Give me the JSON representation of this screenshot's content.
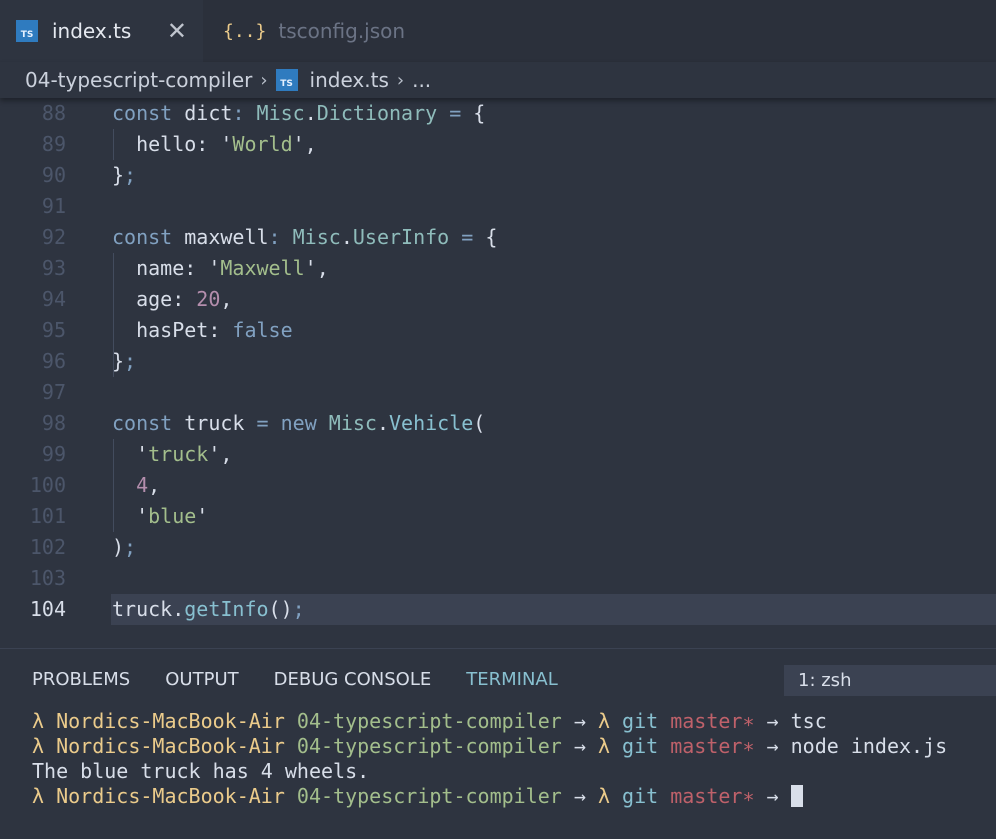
{
  "tabs": [
    {
      "icon": "typescript-file-icon",
      "icon_text": "TS",
      "label": "index.ts",
      "active": true,
      "close": "✕"
    },
    {
      "icon": "json-file-icon",
      "icon_text": "{..}",
      "label": "tsconfig.json",
      "active": false
    }
  ],
  "breadcrumb": {
    "folder": "04-typescript-compiler",
    "separator": "›",
    "file_icon_text": "TS",
    "file": "index.ts",
    "ellipsis": "..."
  },
  "editor": {
    "current_line": "104",
    "lines": [
      {
        "n": "88",
        "code": [
          [
            "kw",
            "const"
          ],
          [
            "pl",
            " dict"
          ],
          [
            "op",
            ":"
          ],
          [
            "pl",
            " "
          ],
          [
            "ty",
            "Misc"
          ],
          [
            "pl",
            "."
          ],
          [
            "ty",
            "Dictionary"
          ],
          [
            "pl",
            " "
          ],
          [
            "op",
            "="
          ],
          [
            "pl",
            " {"
          ]
        ]
      },
      {
        "n": "89",
        "code": [
          [
            "pl",
            "  hello: '"
          ],
          [
            "str",
            "World"
          ],
          [
            "pl",
            "',"
          ]
        ]
      },
      {
        "n": "90",
        "code": [
          [
            "pl",
            "}"
          ],
          [
            "op",
            ";"
          ]
        ]
      },
      {
        "n": "91",
        "code": []
      },
      {
        "n": "92",
        "code": [
          [
            "kw",
            "const"
          ],
          [
            "pl",
            " maxwell"
          ],
          [
            "op",
            ":"
          ],
          [
            "pl",
            " "
          ],
          [
            "ty",
            "Misc"
          ],
          [
            "pl",
            "."
          ],
          [
            "ty",
            "UserInfo"
          ],
          [
            "pl",
            " "
          ],
          [
            "op",
            "="
          ],
          [
            "pl",
            " {"
          ]
        ]
      },
      {
        "n": "93",
        "code": [
          [
            "pl",
            "  name: '"
          ],
          [
            "str",
            "Maxwell"
          ],
          [
            "pl",
            "',"
          ]
        ]
      },
      {
        "n": "94",
        "code": [
          [
            "pl",
            "  age: "
          ],
          [
            "num",
            "20"
          ],
          [
            "pl",
            ","
          ]
        ]
      },
      {
        "n": "95",
        "code": [
          [
            "pl",
            "  hasPet: "
          ],
          [
            "kw",
            "false"
          ]
        ]
      },
      {
        "n": "96",
        "code": [
          [
            "pl",
            "}"
          ],
          [
            "op",
            ";"
          ]
        ]
      },
      {
        "n": "97",
        "code": []
      },
      {
        "n": "98",
        "code": [
          [
            "kw",
            "const"
          ],
          [
            "pl",
            " truck "
          ],
          [
            "op",
            "="
          ],
          [
            "pl",
            " "
          ],
          [
            "kw",
            "new"
          ],
          [
            "pl",
            " "
          ],
          [
            "ty",
            "Misc"
          ],
          [
            "pl",
            "."
          ],
          [
            "fn",
            "Vehicle"
          ],
          [
            "pl",
            "("
          ]
        ]
      },
      {
        "n": "99",
        "code": [
          [
            "pl",
            "  '"
          ],
          [
            "str",
            "truck"
          ],
          [
            "pl",
            "',"
          ]
        ]
      },
      {
        "n": "100",
        "code": [
          [
            "pl",
            "  "
          ],
          [
            "num",
            "4"
          ],
          [
            "pl",
            ","
          ]
        ]
      },
      {
        "n": "101",
        "code": [
          [
            "pl",
            "  '"
          ],
          [
            "str",
            "blue"
          ],
          [
            "pl",
            "'"
          ]
        ]
      },
      {
        "n": "102",
        "code": [
          [
            "pl",
            ")"
          ],
          [
            "op",
            ";"
          ]
        ]
      },
      {
        "n": "103",
        "code": []
      },
      {
        "n": "104",
        "code": [
          [
            "pl",
            "truck."
          ],
          [
            "fn",
            "getInfo"
          ],
          [
            "pl",
            "()"
          ],
          [
            "op",
            ";"
          ]
        ]
      }
    ]
  },
  "panel": {
    "tabs": [
      "PROBLEMS",
      "OUTPUT",
      "DEBUG CONSOLE",
      "TERMINAL"
    ],
    "active_tab": "TERMINAL",
    "terminal_select": "1: zsh"
  },
  "terminal": {
    "lines": [
      [
        [
          "t-yellow",
          "λ Nordics-MacBook-Air "
        ],
        [
          "t-green",
          "04-typescript-compiler"
        ],
        [
          "t-white",
          " → "
        ],
        [
          "t-yellow",
          "λ "
        ],
        [
          "t-cyan",
          "git "
        ],
        [
          "t-red",
          "master∗"
        ],
        [
          "t-white",
          " → tsc"
        ]
      ],
      [
        [
          "t-yellow",
          "λ Nordics-MacBook-Air "
        ],
        [
          "t-green",
          "04-typescript-compiler"
        ],
        [
          "t-white",
          " → "
        ],
        [
          "t-yellow",
          "λ "
        ],
        [
          "t-cyan",
          "git "
        ],
        [
          "t-red",
          "master∗"
        ],
        [
          "t-white",
          " → node index.js"
        ]
      ],
      [
        [
          "t-white",
          "The blue truck has 4 wheels."
        ]
      ],
      [
        [
          "t-yellow",
          "λ Nordics-MacBook-Air "
        ],
        [
          "t-green",
          "04-typescript-compiler"
        ],
        [
          "t-white",
          " → "
        ],
        [
          "t-yellow",
          "λ "
        ],
        [
          "t-cyan",
          "git "
        ],
        [
          "t-red",
          "master∗"
        ],
        [
          "t-white",
          " → "
        ]
      ]
    ]
  },
  "colors": {
    "background": "#2e3440",
    "keyword": "#81a1c1",
    "type": "#8fbcbb",
    "string": "#a3be8c",
    "number": "#b48ead",
    "accent": "#88c0d0"
  }
}
